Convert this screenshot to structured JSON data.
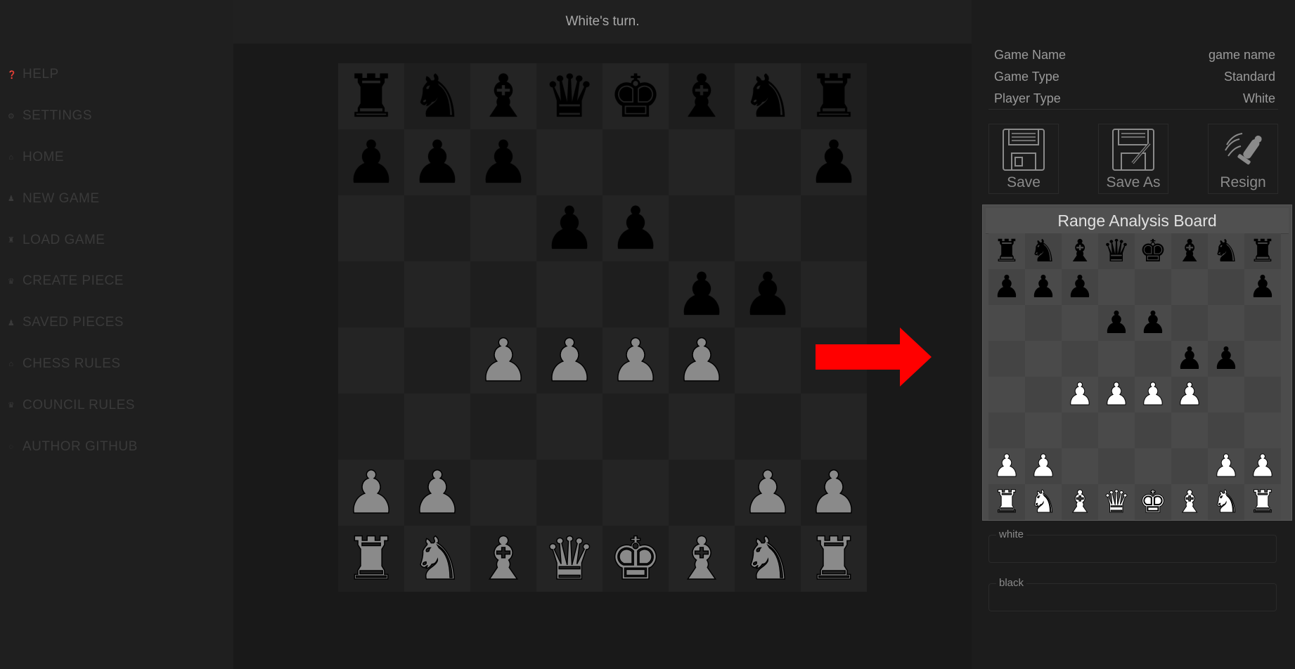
{
  "sidebar": {
    "items": [
      {
        "icon": "help-icon",
        "glyph": "❓",
        "label": "HELP"
      },
      {
        "icon": "gear-icon",
        "glyph": "⚙",
        "label": "SETTINGS"
      },
      {
        "icon": "home-icon",
        "glyph": "⌂",
        "label": "HOME"
      },
      {
        "icon": "pawn-icon",
        "glyph": "♟",
        "label": "NEW GAME"
      },
      {
        "icon": "rook-icon",
        "glyph": "♜",
        "label": "LOAD GAME"
      },
      {
        "icon": "queen-icon",
        "glyph": "♛",
        "label": "CREATE PIECE"
      },
      {
        "icon": "pawn-icon",
        "glyph": "♟",
        "label": "SAVED PIECES"
      },
      {
        "icon": "home-icon",
        "glyph": "⌂",
        "label": "CHESS RULES"
      },
      {
        "icon": "crown-icon",
        "glyph": "♛",
        "label": "COUNCIL RULES"
      },
      {
        "icon": "github-icon",
        "glyph": "◌",
        "label": "AUTHOR GITHUB"
      }
    ]
  },
  "status": {
    "turn": "White's turn."
  },
  "board": {
    "rows": [
      [
        "bR",
        "bN",
        "bB",
        "bQ",
        "bK",
        "bB",
        "bN",
        "bR"
      ],
      [
        "bP",
        "bP",
        "bP",
        "",
        "",
        "",
        "",
        "bP"
      ],
      [
        "",
        "",
        "",
        "bP",
        "bP",
        "",
        "",
        ""
      ],
      [
        "",
        "",
        "",
        "",
        "",
        "bP",
        "bP",
        ""
      ],
      [
        "",
        "",
        "wP",
        "wP",
        "wP",
        "wP",
        "",
        ""
      ],
      [
        "",
        "",
        "",
        "",
        "",
        "",
        "",
        ""
      ],
      [
        "wP",
        "wP",
        "",
        "",
        "",
        "",
        "wP",
        "wP"
      ],
      [
        "wR",
        "wN",
        "wB",
        "wQ",
        "wK",
        "wB",
        "wN",
        "wR"
      ]
    ]
  },
  "pieces": {
    "K": "♚",
    "Q": "♛",
    "R": "♜",
    "B": "♝",
    "N": "♞",
    "P": "♟"
  },
  "game_info": [
    {
      "label": "Game Name",
      "value": "game name"
    },
    {
      "label": "Game Type",
      "value": "Standard"
    },
    {
      "label": "Player Type",
      "value": "White"
    }
  ],
  "actions": {
    "save": "Save",
    "save_as": "Save As",
    "resign": "Resign"
  },
  "range_board": {
    "title": "Range Analysis Board"
  },
  "sides": {
    "white": "white",
    "black": "black"
  },
  "colors": {
    "arrow": "#ff0000"
  }
}
